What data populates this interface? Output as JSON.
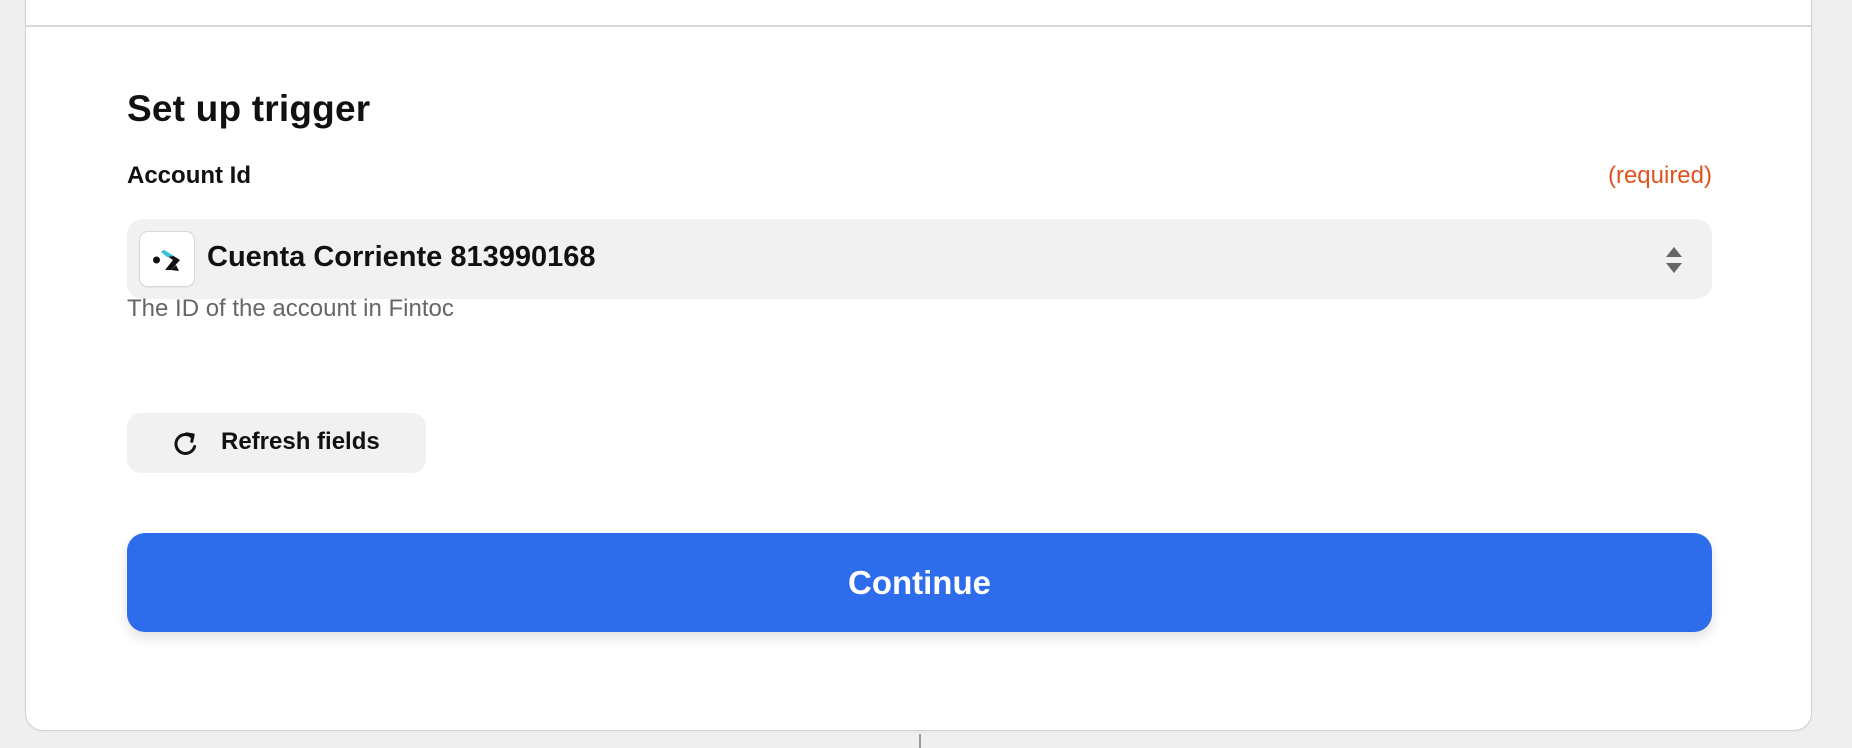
{
  "trigger_setup": {
    "title": "Set up trigger",
    "account_field": {
      "label": "Account Id",
      "required_label": "(required)",
      "selected_value": "Cuenta Corriente 813990168",
      "help_text": "The ID of the account in Fintoc",
      "app_icon": "fintoc-app-icon",
      "select_control_icon": "up-down-select-arrows-icon"
    },
    "refresh_button": {
      "label": "Refresh fields",
      "icon": "refresh-icon"
    },
    "continue_button": {
      "label": "Continue"
    }
  },
  "colors": {
    "required": "#e0531f",
    "primary_button": "#2d6cea",
    "select_background": "#f1f1f1",
    "help_text": "#666666"
  }
}
